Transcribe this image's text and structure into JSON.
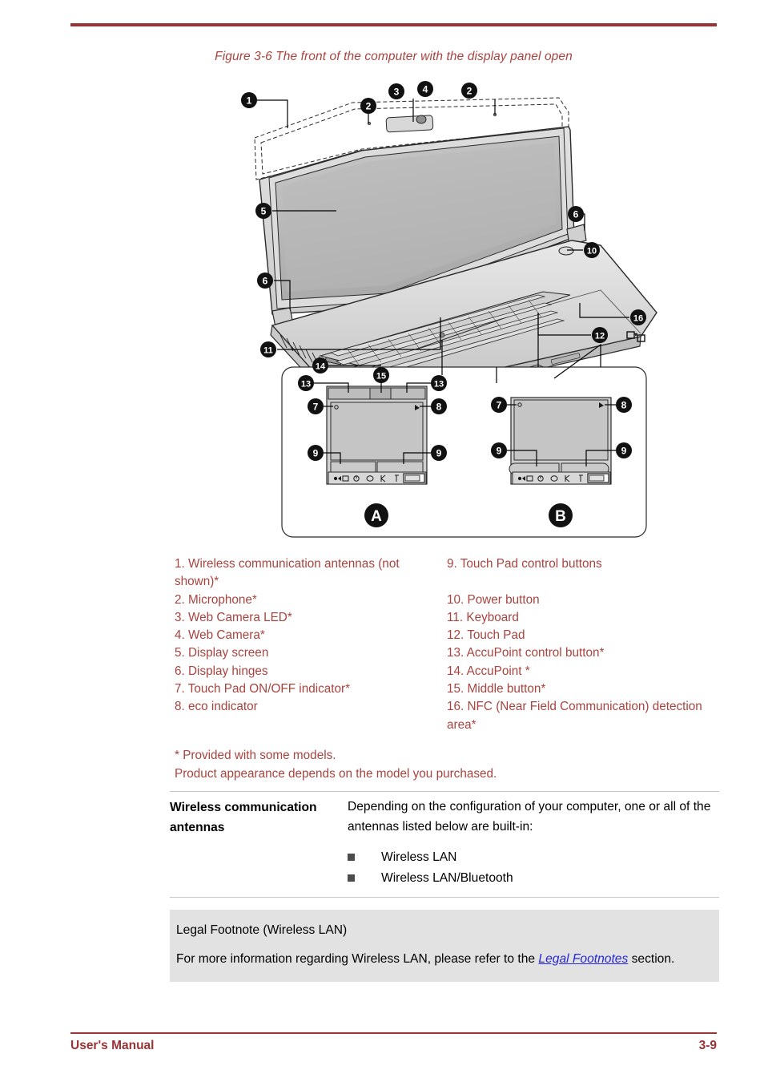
{
  "figure": {
    "caption": "Figure 3-6 The front of the computer with the display panel open",
    "callouts": [
      "1",
      "2",
      "3",
      "4",
      "5",
      "6",
      "7",
      "8",
      "9",
      "10",
      "11",
      "12",
      "13",
      "14",
      "15",
      "16"
    ],
    "variant_labels": [
      "A",
      "B"
    ],
    "icons": {
      "nfc": "nfc-detection-icon"
    }
  },
  "legend": {
    "left": [
      "1. Wireless communication antennas (not shown)*",
      "2. Microphone*",
      "3. Web Camera LED*",
      "4. Web Camera*",
      "5. Display screen",
      "6. Display hinges",
      "7. Touch Pad ON/OFF indicator*",
      "8. eco indicator"
    ],
    "right": [
      "9. Touch Pad control buttons",
      "10. Power button",
      "11. Keyboard",
      "12. Touch Pad",
      "13. AccuPoint control button*",
      "14. AccuPoint *",
      "15. Middle button*",
      "16. NFC (Near Field Communication) detection area*"
    ]
  },
  "notes": {
    "line1": "* Provided with some models.",
    "line2": "Product appearance depends on the model you purchased."
  },
  "definition": {
    "term": "Wireless communication antennas",
    "body": "Depending on the configuration of your computer, one or all of the antennas listed below are built-in:",
    "bullets": [
      "Wireless LAN",
      "Wireless LAN/Bluetooth"
    ]
  },
  "legal": {
    "title": "Legal Footnote (Wireless LAN)",
    "body_before": "For more information regarding Wireless LAN, please refer to the ",
    "link": "Legal Footnotes",
    "body_after": " section."
  },
  "footer": {
    "left": "User's Manual",
    "right": "3-9"
  },
  "colors": {
    "accent": "#9b3235",
    "caption": "#a8443f",
    "link": "#2727d8",
    "panel": "#e2e2e2"
  }
}
